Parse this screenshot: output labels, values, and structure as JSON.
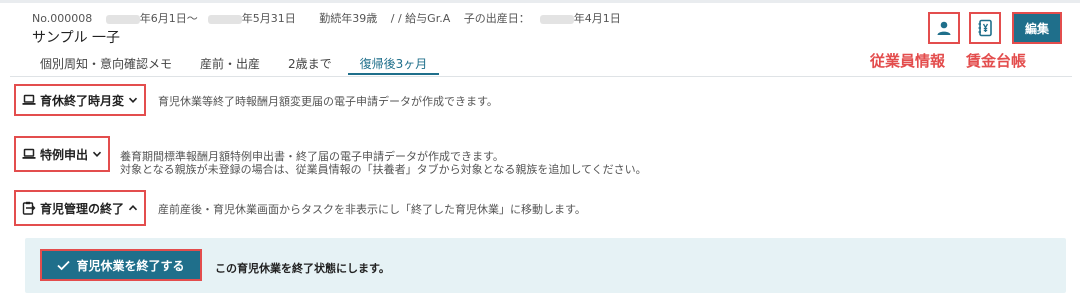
{
  "header": {
    "employee_no": "No.000008",
    "period_start": "年6月1日〜",
    "period_end": "年5月31日",
    "tenure": "勤続年39歳",
    "pay_group": "/ / 給与Gr.A",
    "birth_label": "子の出産日：",
    "birth_date": "年4月1日",
    "employee_name": "サンプル 一子"
  },
  "tabs": [
    "個別周知・意向確認メモ",
    "産前・出産",
    "2歳まで",
    "復帰後3ヶ月"
  ],
  "active_tab": "復帰後3ヶ月",
  "toolbar": {
    "edit_label": "編集",
    "employee_info_label": "従業員情報",
    "wage_ledger_label": "賃金台帳"
  },
  "actions": {
    "childcare_end_change": {
      "label": "育休終了時月変",
      "description": "育児休業等終了時報酬月額変更届の電子申請データが作成できます。"
    },
    "special_application": {
      "label": "特例申出",
      "description_line1": "養育期間標準報酬月額特例申出書・終了届の電子申請データが作成できます。",
      "description_line2": "対象となる親族が未登録の場合は、従業員情報の「扶養者」タブから対象となる親族を追加してください。"
    },
    "childcare_management_end": {
      "label": "育児管理の終了",
      "description": "産前産後・育児休業画面からタスクを非表示にし「終了した育児休業」に移動します。"
    }
  },
  "finish_panel": {
    "button_label": "育児休業を終了する",
    "description": "この育児休業を終了状態にします。"
  },
  "colors": {
    "accent": "#1f6f8b",
    "highlight_border": "#e34d4d",
    "panel_bg": "#e6f2f5"
  }
}
